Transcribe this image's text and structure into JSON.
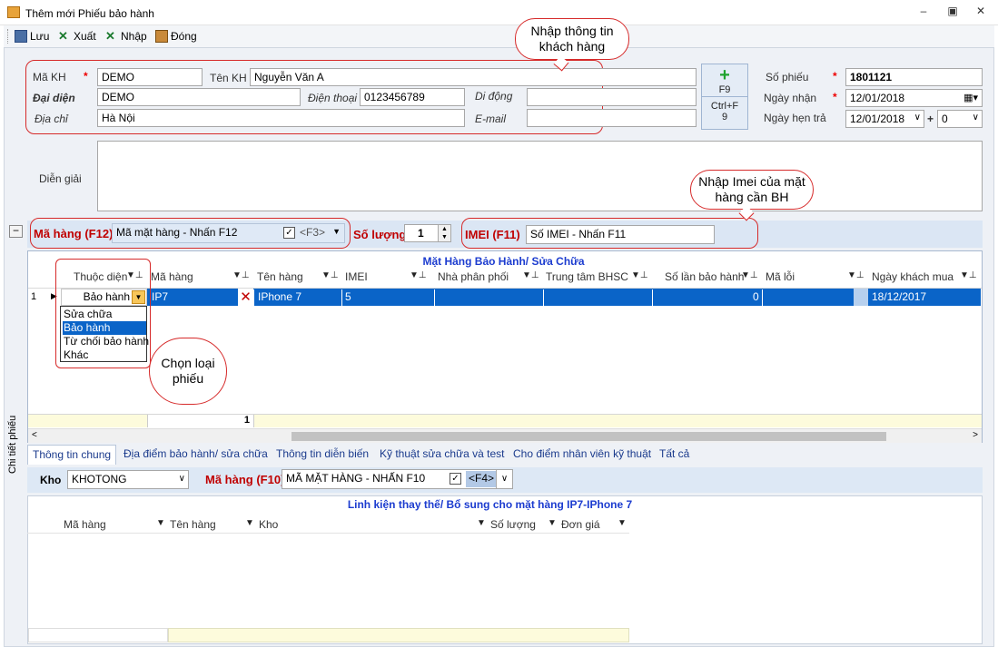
{
  "window": {
    "title": "Thêm mới Phiếu bảo hành"
  },
  "toolbar": {
    "save": "Lưu",
    "export": "Xuất",
    "import": "Nhập",
    "close": "Đóng"
  },
  "customer": {
    "code_label": "Mã KH",
    "code_value": "DEMO",
    "name_label": "Tên KH",
    "name_value": "Nguyễn Văn A",
    "rep_label": "Đại diện",
    "rep_value": "DEMO",
    "phone_label": "Điện thoại",
    "phone_value": "0123456789",
    "mobile_label": "Di động",
    "mobile_value": "",
    "address_label": "Địa chỉ",
    "address_value": "Hà Nội",
    "email_label": "E-mail",
    "email_value": ""
  },
  "buttons": {
    "add_key": "F9",
    "search_key_line1": "Ctrl+F",
    "search_key_line2": "9"
  },
  "ticket": {
    "number_label": "Số phiếu",
    "number_value": "1801121",
    "received_label": "Ngày nhận",
    "received_value": "12/01/2018",
    "due_label": "Ngày hẹn trả",
    "due_value": "12/01/2018",
    "plus": "+",
    "days_value": "0"
  },
  "description": {
    "label": "Diễn giải",
    "value": ""
  },
  "item_entry": {
    "item_label": "Mã hàng (F12)",
    "item_placeholder": "Mã mặt hàng - Nhấn F12",
    "item_hint": "<F3>",
    "qty_label": "Số lượng",
    "qty_value": "1",
    "imei_label": "IMEI (F11)",
    "imei_placeholder": "Số IMEI - Nhấn F11",
    "collapse": "−"
  },
  "callouts": {
    "customer": "Nhập thông tin khách hàng",
    "imei": "Nhập Imei của mặt hàng cần BH",
    "type": "Chọn loại phiếu"
  },
  "grid": {
    "caption": "Mặt Hàng Bảo Hành/  Sửa Chữa",
    "columns": [
      "Thuộc diện",
      "Mã hàng",
      "Tên hàng",
      "IMEI",
      "Nhà phân phối",
      "Trung tâm BHSC",
      "Số lần bảo hành",
      "Mã lỗi",
      "Ngày khách mua"
    ],
    "row": {
      "index": "1",
      "type": "Bảo hành",
      "code": "IP7",
      "name": "IPhone 7",
      "imei": "5",
      "distributor": "",
      "center": "",
      "times": "0",
      "error": "",
      "bought": "18/12/2017"
    },
    "type_options": [
      "Sửa chữa",
      "Bảo hành",
      "Từ chối bảo hành",
      "Khác"
    ],
    "footer_count": "1"
  },
  "tabs": [
    "Thông tin chung",
    "Địa điểm  bảo hành/ sửa chữa",
    "Thông tin diễn biến",
    "Kỹ thuật sửa chữa và test",
    "Cho điểm nhân viên kỹ thuật",
    "Tất cả"
  ],
  "parts": {
    "warehouse_label": "Kho",
    "warehouse_value": "KHOTONG",
    "item_label": "Mã hàng (F10)",
    "item_placeholder": "MÃ MẶT HÀNG - NHẤN F10",
    "item_hint": "<F4>",
    "caption": "Linh kiện thay thế/ Bổ sung cho mặt hàng IP7-IPhone 7",
    "columns": [
      "Mã hàng",
      "Tên hàng",
      "Kho",
      "Số lượng",
      "Đơn giá"
    ]
  },
  "side_label": "Chi tiết phiếu"
}
